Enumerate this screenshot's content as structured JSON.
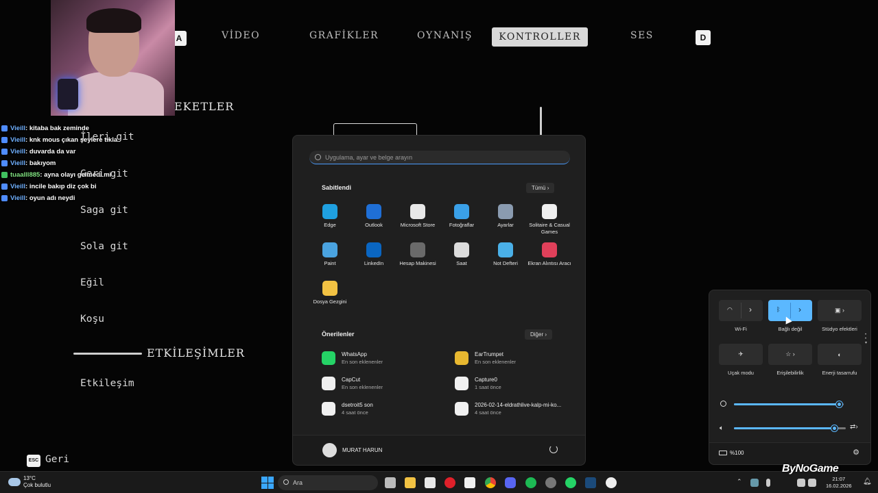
{
  "game": {
    "tabs": [
      {
        "label": "A"
      },
      {
        "label": "VİDEO"
      },
      {
        "label": "GRAFİKLER"
      },
      {
        "label": "OYNANIŞ"
      },
      {
        "label": "KONTROLLER"
      },
      {
        "label": "SES"
      }
    ],
    "right_key": "D",
    "section_movement": "EKETLER",
    "items": [
      "Saga git",
      "Sola git",
      "Eğil",
      "Koşu"
    ],
    "partial_items": [
      "İleri git",
      "Geri git"
    ],
    "section_interactions": "ETKİLEŞİMLER",
    "interaction_item": "Etkileşim",
    "back_key": "ESC",
    "back_label": "Geri"
  },
  "chat": [
    {
      "user": "Vieill",
      "msg": ": kitaba bak zeminde",
      "color": "blue"
    },
    {
      "user": "Vieill",
      "msg": ": knk mous çıkan şeylere tıkla",
      "color": "blue"
    },
    {
      "user": "Vieill",
      "msg": ": duvarda da var",
      "color": "blue"
    },
    {
      "user": "Vieill",
      "msg": ": bakıyom",
      "color": "blue"
    },
    {
      "user": "tuaalll885",
      "msg": ": ayna olayı gelmedi mi",
      "color": "green"
    },
    {
      "user": "Vieill",
      "msg": ": incile bakıp diz çok bi",
      "color": "blue"
    },
    {
      "user": "Vieill",
      "msg": ": oyun adı neydi",
      "color": "blue"
    }
  ],
  "start_menu": {
    "search_placeholder": "Uygulama, ayar ve belge arayın",
    "pinned_title": "Sabitlendi",
    "pinned_more": "Tümü",
    "pinned": [
      {
        "label": "Edge",
        "icon": "edge-icon",
        "color": "#1fa0e0"
      },
      {
        "label": "Outlook",
        "icon": "outlook-icon",
        "color": "#1f6fd6"
      },
      {
        "label": "Microsoft Store",
        "icon": "store-icon",
        "color": "#e8e8e8"
      },
      {
        "label": "Fotoğraflar",
        "icon": "photos-icon",
        "color": "#3aa0e8"
      },
      {
        "label": "Ayarlar",
        "icon": "gear-icon",
        "color": "#8a9bb0"
      },
      {
        "label": "Solitaire & Casual Games",
        "icon": "cards-icon",
        "color": "#f0f0f0"
      },
      {
        "label": "Paint",
        "icon": "paint-icon",
        "color": "#4aa3e0"
      },
      {
        "label": "LinkedIn",
        "icon": "linkedin-icon",
        "color": "#0a66c2"
      },
      {
        "label": "Hesap Makinesi",
        "icon": "calculator-icon",
        "color": "#6a6a6a"
      },
      {
        "label": "Saat",
        "icon": "clock-icon",
        "color": "#dcdcdc"
      },
      {
        "label": "Not Defteri",
        "icon": "notepad-icon",
        "color": "#4ab0e8"
      },
      {
        "label": "Ekran Alıntısı Aracı",
        "icon": "snipping-icon",
        "color": "#e0405a"
      },
      {
        "label": "Dosya Gezgini",
        "icon": "folder-icon",
        "color": "#f2c243"
      }
    ],
    "recommended_title": "Önerilenler",
    "recommended_more": "Diğer",
    "recommended": [
      {
        "name": "WhatsApp",
        "sub": "En son eklenenler",
        "icon": "whatsapp-icon",
        "color": "#25d366"
      },
      {
        "name": "EarTrumpet",
        "sub": "En son eklenenler",
        "icon": "eartrumpet-icon",
        "color": "#e8b830"
      },
      {
        "name": "CapCut",
        "sub": "En son eklenenler",
        "icon": "capcut-icon",
        "color": "#f0f0f0"
      },
      {
        "name": "Capture0",
        "sub": "1 saat önce",
        "icon": "image-file-icon",
        "color": "#f0f0f0"
      },
      {
        "name": "dsetroit5 son",
        "sub": "4 saat önce",
        "icon": "video-file-icon",
        "color": "#f0f0f0"
      },
      {
        "name": "2026-02-14-eldrathlive-kalp-mi-ko...",
        "sub": "4 saat önce",
        "icon": "video-file-icon",
        "color": "#f0f0f0"
      }
    ],
    "user_name": "MURAT HARUN"
  },
  "quick_settings": {
    "tiles": [
      {
        "label": "Wi-Fi",
        "icon": "wifi-icon",
        "on": false
      },
      {
        "label": "Bağlı değil",
        "icon": "bluetooth-icon",
        "on": true
      },
      {
        "label": "Stüdyo efektleri",
        "icon": "camera-effects-icon",
        "on": false
      },
      {
        "label": "Uçak modu",
        "icon": "airplane-icon",
        "on": false
      },
      {
        "label": "Erişilebilirlik",
        "icon": "accessibility-icon",
        "on": false
      },
      {
        "label": "Enerji tasarrufu",
        "icon": "battery-saver-icon",
        "on": false
      }
    ],
    "brightness": 0.96,
    "volume": 0.9,
    "battery_label": "%100"
  },
  "taskbar": {
    "weather_temp": "13°C",
    "weather_desc": "Çok bulutlu",
    "search_label": "Ara",
    "time": "21:07",
    "date": "16.02.2026",
    "watermark": "ByNoGame"
  }
}
